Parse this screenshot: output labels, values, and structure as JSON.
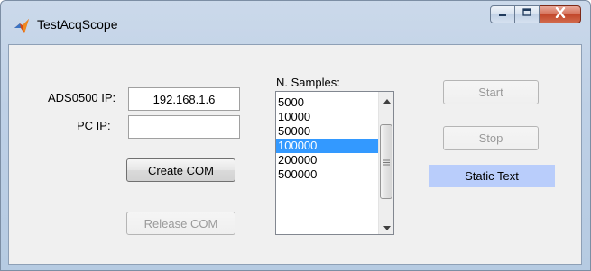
{
  "window": {
    "title": "TestAcqScope",
    "icon": "matlab-icon",
    "controls": {
      "minimize": "minimize-icon",
      "maximize": "maximize-icon",
      "close": "close-icon"
    }
  },
  "form": {
    "ads_ip_label": "ADS0500 IP:",
    "ads_ip_value": "192.168.1.6",
    "pc_ip_label": "PC IP:",
    "pc_ip_value": "",
    "create_com_label": "Create COM",
    "release_com_label": "Release COM",
    "samples_label": "N. Samples:",
    "samples": [
      "5000",
      "10000",
      "50000",
      "100000",
      "200000",
      "500000"
    ],
    "samples_selected": "100000",
    "start_label": "Start",
    "stop_label": "Stop",
    "static_text": "Static Text",
    "static_text_color": "#b9cdfb",
    "selection_color": "#3399ff"
  }
}
